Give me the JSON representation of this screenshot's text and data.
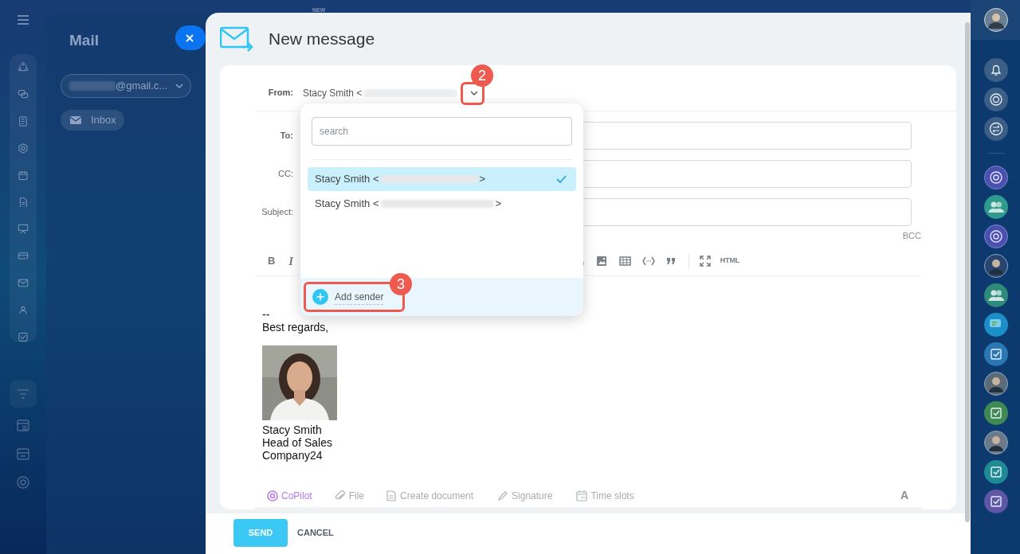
{
  "background_app": {
    "badge": "NEW",
    "title": "Mail",
    "account": "@gmail.c...",
    "folder": "Inbox"
  },
  "window": {
    "title": "New message"
  },
  "from": {
    "label": "From:",
    "value": "Stacy Smith <"
  },
  "fields": [
    {
      "label": "To:",
      "strong": true
    },
    {
      "label": "CC:",
      "strong": false
    },
    {
      "label": "Subject:",
      "strong": false
    }
  ],
  "bcc": "BCC",
  "toolbar": {
    "bold": "B",
    "italic": "I",
    "html": "HTML"
  },
  "body": {
    "separator": "--",
    "closing": "Best regards,",
    "signature": [
      "Stacy Smith",
      "Head of Sales",
      "Company24"
    ]
  },
  "attachments": [
    {
      "kind": "copilot",
      "label": "CoPilot"
    },
    {
      "kind": "file",
      "label": "File"
    },
    {
      "kind": "document",
      "label": "Create document"
    },
    {
      "kind": "signature",
      "label": "Signature"
    },
    {
      "kind": "slots",
      "label": "Time slots"
    }
  ],
  "format_toggle": "A",
  "footer": {
    "send": "SEND",
    "cancel": "CANCEL"
  },
  "sender_dropdown": {
    "search": {
      "placeholder": "search"
    },
    "options": [
      {
        "name": "Stacy Smith <",
        "end": ">",
        "selected": true
      },
      {
        "name": "Stacy Smith <",
        "end": ">",
        "selected": false
      }
    ],
    "add_sender": "Add sender"
  },
  "annotations": [
    {
      "label": "2"
    },
    {
      "label": "3"
    }
  ],
  "right_rail": [
    {
      "kind": "bell"
    },
    {
      "kind": "copilot"
    },
    {
      "kind": "swap"
    },
    {
      "kind": "copilot-chat",
      "color": "#4b4fb0"
    },
    {
      "kind": "group",
      "color": "#2f9a8e"
    },
    {
      "kind": "copilot-chat",
      "color": "#4b4fb0"
    },
    {
      "kind": "person",
      "color": "#27456e"
    },
    {
      "kind": "group",
      "color": "#2f8a7a"
    },
    {
      "kind": "messages",
      "color": "#1c8ec8"
    },
    {
      "kind": "task",
      "color": "#2a77b5"
    },
    {
      "kind": "person",
      "color": "#5b6b78"
    },
    {
      "kind": "task",
      "color": "#3f8a52"
    },
    {
      "kind": "person",
      "color": "#6b7a8a"
    },
    {
      "kind": "task",
      "color": "#1e8a94"
    },
    {
      "kind": "task",
      "color": "#5e57a8"
    }
  ]
}
